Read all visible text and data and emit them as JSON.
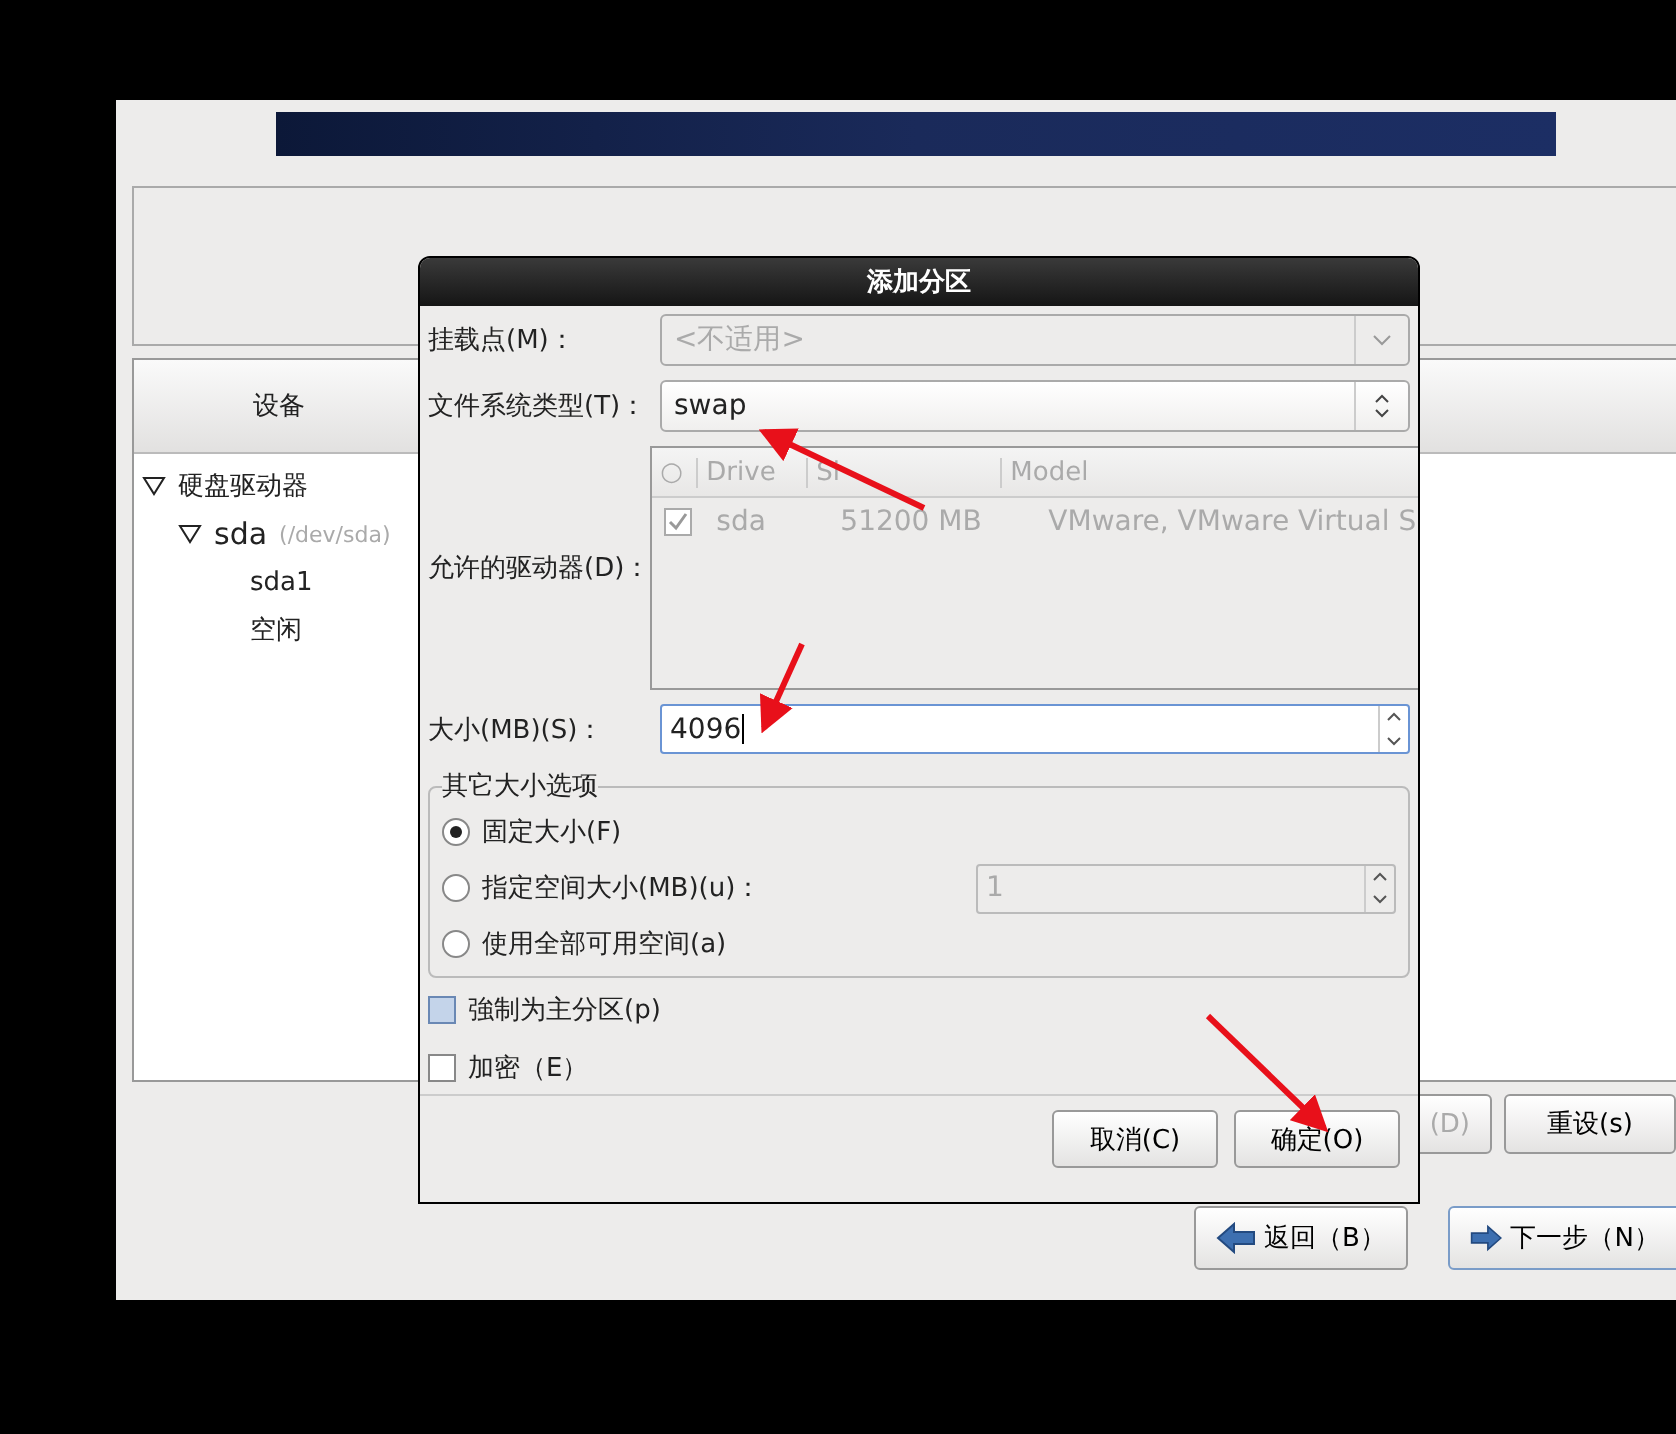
{
  "page": {
    "device_panel": {
      "column": "设备",
      "tree": [
        {
          "label": "硬盘驱动器",
          "expanded": true,
          "children": [
            {
              "label": "sda",
              "detail": "(/dev/sda)",
              "expanded": true,
              "children": [
                {
                  "label": "sda1"
                },
                {
                  "label": "空闲"
                }
              ]
            }
          ]
        }
      ]
    },
    "panel_buttons": [
      {
        "label": "(D)",
        "disabled": true
      },
      {
        "label": "重设(s)",
        "disabled": false
      }
    ],
    "nav_buttons": [
      {
        "label": "返回（B）",
        "kind": "back",
        "focused": false
      },
      {
        "label": "下一步（N）",
        "kind": "next",
        "focused": true
      }
    ]
  },
  "dialog": {
    "title": "添加分区",
    "mount_point": {
      "label": "挂载点(M)：",
      "value": "<不适用>",
      "disabled": true
    },
    "fs_type": {
      "label": "文件系统类型(T)：",
      "value": "swap"
    },
    "drives": {
      "label": "允许的驱动器(D)：",
      "columns": [
        "○",
        "Drive",
        "Si",
        "Model"
      ],
      "rows": [
        {
          "checked": true,
          "drive": "sda",
          "size": "51200 MB",
          "model": "VMware, VMware Virtual S"
        }
      ]
    },
    "size": {
      "label": "大小(MB)(S)：",
      "value": "4096"
    },
    "size_options": {
      "title": "其它大小选项",
      "options": [
        {
          "label": "固定大小(F)",
          "selected": true
        },
        {
          "label": "指定空间大小(MB)(u)：",
          "selected": false,
          "spin_value": "1"
        },
        {
          "label": "使用全部可用空间(a)",
          "selected": false
        }
      ]
    },
    "checkboxes": [
      {
        "label": "強制为主分区(p)",
        "checked": false,
        "hover": true
      },
      {
        "label": "加密（E）",
        "checked": false,
        "hover": false
      }
    ],
    "buttons": [
      "取消(C)",
      "确定(O)"
    ]
  }
}
